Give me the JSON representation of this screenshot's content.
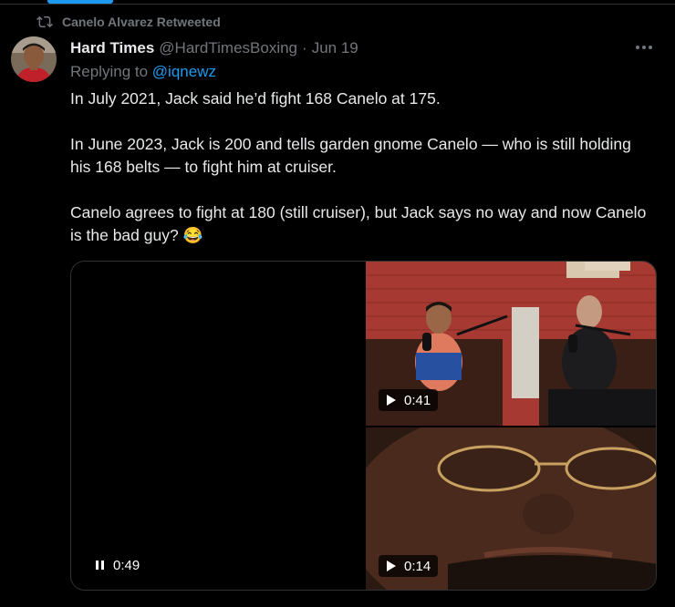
{
  "retweet": {
    "label": "Canelo Alvarez Retweeted",
    "icon": "retweet-icon"
  },
  "author": {
    "name": "Hard Times",
    "handle": "@HardTimesBoxing",
    "separator": "·",
    "date": "Jun 19"
  },
  "reply": {
    "prefix": "Replying to",
    "mention": "@iqnewz"
  },
  "tweet": {
    "paragraphs": [
      "In July 2021, Jack said he’d fight 168 Canelo at 175.",
      "In June 2023, Jack is 200 and tells garden gnome Canelo — who is still holding his 168 belts — to fight him at cruiser.",
      "Canelo agrees to fight at 180 (still cruiser), but Jack says no way and now Canelo is the bad guy? 😂"
    ]
  },
  "media": {
    "left_video": {
      "duration": "0:49",
      "state_icon": "pause-icon"
    },
    "right_top_video": {
      "duration": "0:41",
      "state_icon": "play-icon"
    },
    "right_bottom_video": {
      "duration": "0:14",
      "state_icon": "play-icon"
    }
  },
  "colors": {
    "accent": "#1d9bf0",
    "muted": "#71767b",
    "text": "#e7e9ea",
    "background": "#000000"
  }
}
